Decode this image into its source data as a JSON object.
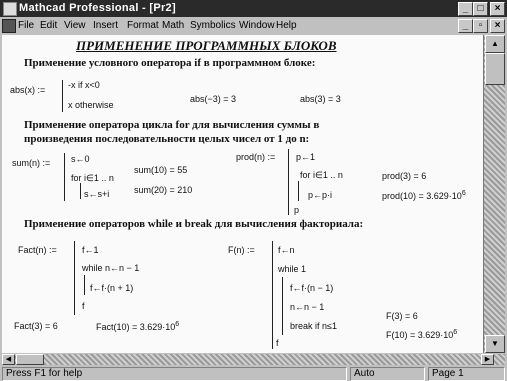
{
  "window": {
    "title": "Mathcad Professional - [Pr2]"
  },
  "menu": [
    "File",
    "Edit",
    "View",
    "Insert",
    "Format",
    "Math",
    "Symbolics",
    "Window",
    "Help"
  ],
  "document": {
    "title": "ПРИМЕНЕНИЕ ПРОГРАММНЫХ БЛОКОВ",
    "section1": {
      "heading": "Применение условного оператора if в программном блоке:",
      "def_lhs": "abs(x) :=",
      "line1": "-x  if  x<0",
      "line2": "x  otherwise",
      "eval1": "abs(−3) = 3",
      "eval2": "abs(3) = 3"
    },
    "section2": {
      "heading_line1": "Применение оператора цикла for для вычисления суммы в",
      "heading_line2": "произведения последовательности целых чисел от 1 до n:",
      "sum_lhs": "sum(n) :=",
      "sum_line1": "s←0",
      "sum_line2": "for  i∈1 .. n",
      "sum_line3": "s←s+i",
      "sum_eval1": "sum(10) = 55",
      "sum_eval2": "sum(20) = 210",
      "prod_lhs": "prod(n) :=",
      "prod_line1": "p←1",
      "prod_line2": "for  i∈1 .. n",
      "prod_line3": "p←p·i",
      "prod_line4": "p",
      "prod_eval1": "prod(3) = 6",
      "prod_eval2": "prod(10) = 3.629·10",
      "prod_eval2_exp": "6"
    },
    "section3": {
      "heading": "Применение операторов while и break для вычисления факториала:",
      "fact_lhs": "Fact(n) :=",
      "fact_line1": "f←1",
      "fact_line2": "while  n←n − 1",
      "fact_line3": "f←f·(n + 1)",
      "fact_line4": "f",
      "fact_eval1": "Fact(3) = 6",
      "fact_eval2": "Fact(10) = 3.629·10",
      "fact_eval2_exp": "6",
      "f_lhs": "F(n) :=",
      "f_line1": "f←n",
      "f_line2": "while  1",
      "f_line3": "f←f·(n − 1)",
      "f_line4": "n←n − 1",
      "f_line5": "break  if  n≤1",
      "f_line6": "f",
      "f_eval1": "F(3) = 6",
      "f_eval2": "F(10) = 3.629·10",
      "f_eval2_exp": "6"
    }
  },
  "status": {
    "help": "Press F1 for help",
    "mode": "Auto",
    "page": "Page 1"
  }
}
